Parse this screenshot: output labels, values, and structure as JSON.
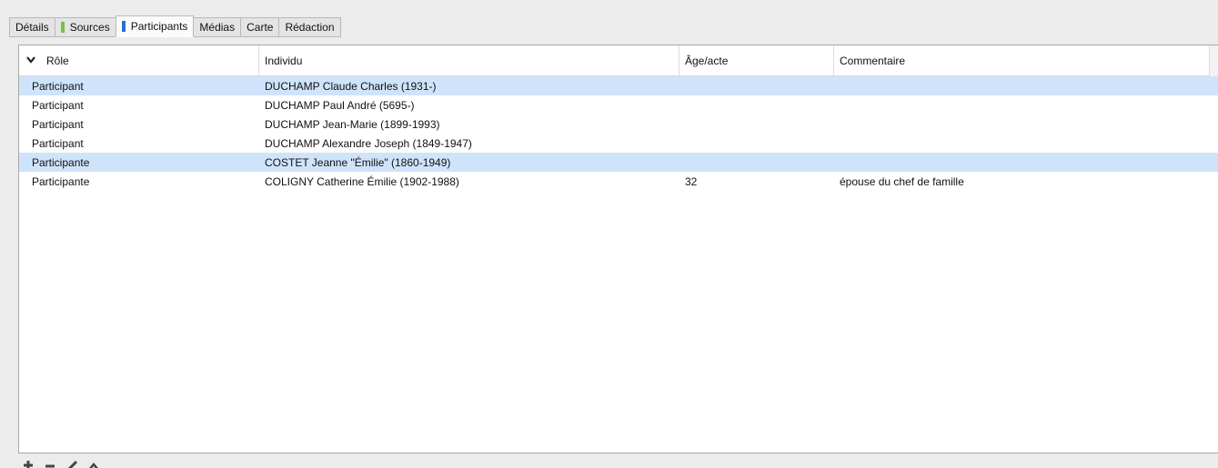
{
  "tabs": [
    {
      "label": "Détails",
      "marker": null
    },
    {
      "label": "Sources",
      "marker": "#7ac142"
    },
    {
      "label": "Participants",
      "marker": "#2a6fc9"
    },
    {
      "label": "Médias",
      "marker": null
    },
    {
      "label": "Carte",
      "marker": null
    },
    {
      "label": "Rédaction",
      "marker": null
    }
  ],
  "table": {
    "headers": {
      "role": "Rôle",
      "individual": "Individu",
      "age": "Âge/acte",
      "comment": "Commentaire"
    },
    "rows": [
      {
        "role": "Participant",
        "individual": "DUCHAMP Claude Charles (1931-)",
        "age": "",
        "comment": "",
        "selected": true
      },
      {
        "role": "Participant",
        "individual": "DUCHAMP Paul André (5695-)",
        "age": "",
        "comment": "",
        "selected": false
      },
      {
        "role": "Participant",
        "individual": "DUCHAMP Jean-Marie (1899-1993)",
        "age": "",
        "comment": "",
        "selected": false
      },
      {
        "role": "Participant",
        "individual": "DUCHAMP Alexandre Joseph (1849-1947)",
        "age": "",
        "comment": "",
        "selected": false
      },
      {
        "role": "Participante",
        "individual": "COSTET Jeanne \"Émilie\" (1860-1949)",
        "age": "",
        "comment": "",
        "selected": true
      },
      {
        "role": "Participante",
        "individual": "COLIGNY Catherine Émilie (1902-1988)",
        "age": "32",
        "comment": "épouse du chef de famille",
        "selected": false
      }
    ]
  },
  "toolbar": {
    "icons": [
      "add-icon",
      "remove-icon",
      "edit-icon",
      "move-up-icon"
    ]
  },
  "colors": {
    "selection": "#cfe3fb",
    "sources_marker": "#7ac142",
    "participants_marker": "#2a6fc9"
  }
}
